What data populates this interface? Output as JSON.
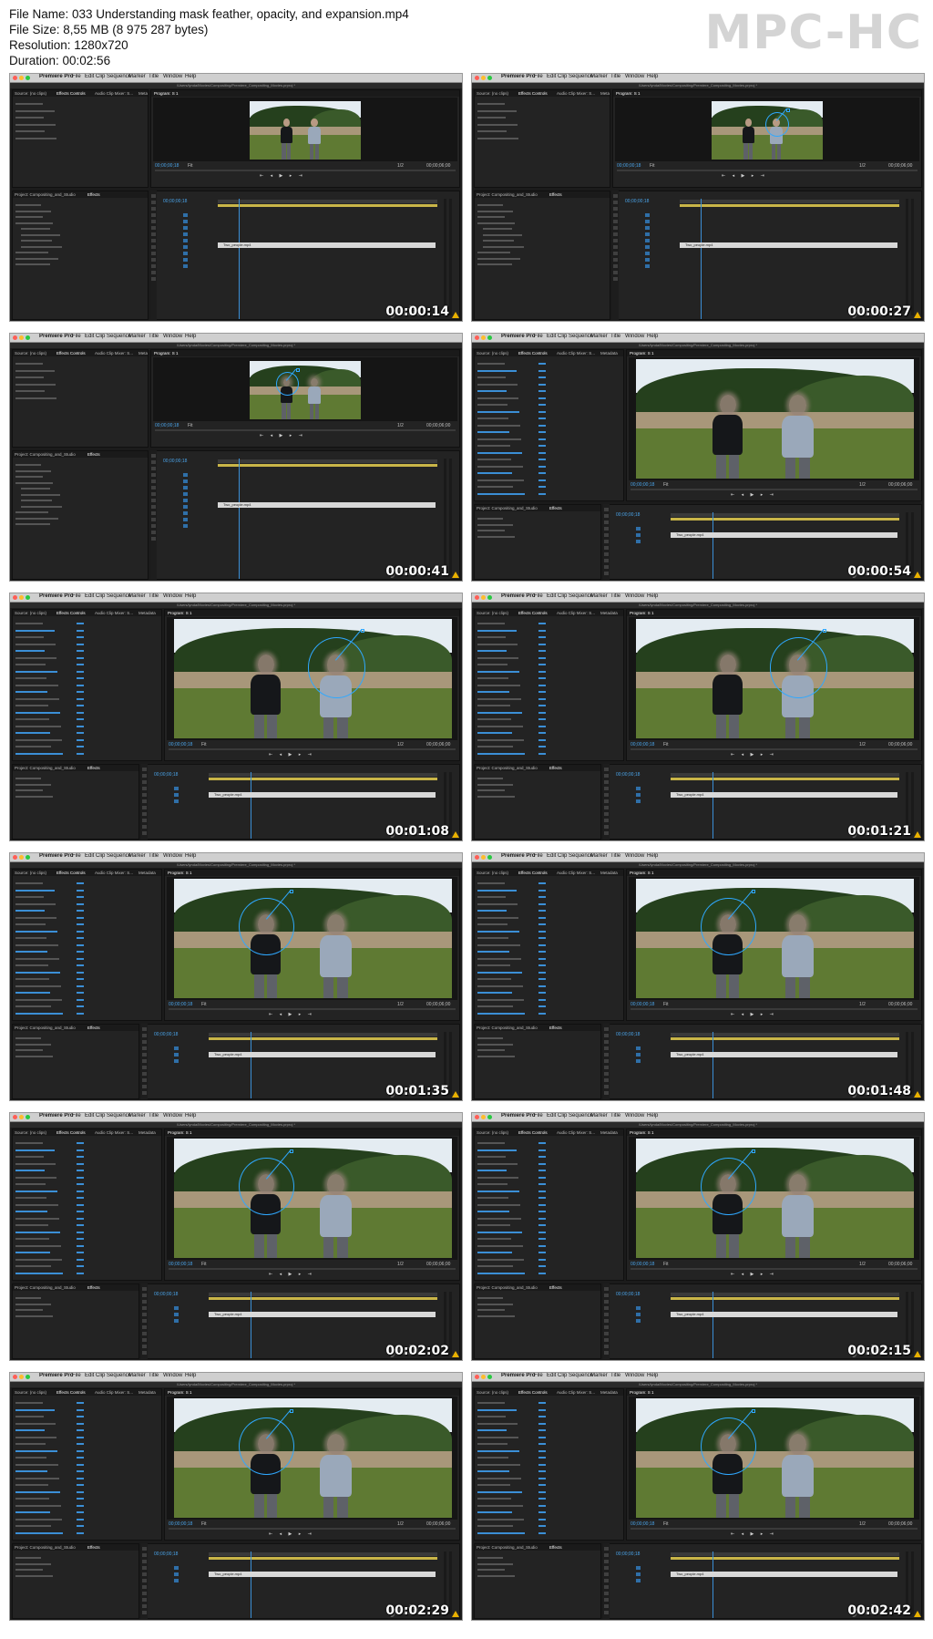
{
  "header": {
    "file_name": "File Name: 033 Understanding mask feather, opacity, and expansion.mp4",
    "file_size": "File Size: 8,55 MB (8 975 287 bytes)",
    "resolution": "Resolution: 1280x720",
    "duration": "Duration: 00:02:56",
    "logo": "MPC-HC"
  },
  "app": {
    "menu": [
      "Premiere Pro",
      "File",
      "Edit",
      "Clip",
      "Sequence",
      "Marker",
      "Title",
      "Window",
      "Help"
    ],
    "window_title": "/Users/lynda/Movies/Compositing/Premiere_Compositing_Movies.prproj *",
    "tabs_top": [
      "Source: (no clips)",
      "Effects Controls",
      "Audio Clip Mixer: S...",
      "Metadata"
    ],
    "tab_program": "Program: S 1",
    "tabs_bottom_left": [
      "Project: Compositing_and_Studio",
      "Effects"
    ],
    "timecode": "00;00;00;18",
    "timecode_end": "00;00;06;00",
    "fit": "Fit",
    "ratio": "1/2",
    "effects_rows": [
      "Presets",
      "Audio Effects",
      "Audio Transitions",
      "Video Effects",
      "Blur & Sharpen",
      "Face Blur",
      "Color Correction",
      "Fast Color Corrector",
      "Video Transitions",
      "Obsolete FX",
      "Lumetri Looks"
    ],
    "controls_rows": [
      "Motion",
      "Opacity",
      "Time Remapping",
      "Face Blur",
      "Mask (1)",
      "Mask Path",
      "Mask Feather",
      "Mask Opacity",
      "Mask Expansion",
      "Inverted",
      "Mask (2)",
      "Blurriness"
    ],
    "clip_name": "Two_people.mp4",
    "watermark": "lynda"
  },
  "thumbnails": [
    {
      "stamp": "00:00:14",
      "layout": "small"
    },
    {
      "stamp": "00:00:27",
      "layout": "small"
    },
    {
      "stamp": "00:00:41",
      "layout": "small"
    },
    {
      "stamp": "00:00:54",
      "layout": "large"
    },
    {
      "stamp": "00:01:08",
      "layout": "large"
    },
    {
      "stamp": "00:01:21",
      "layout": "large"
    },
    {
      "stamp": "00:01:35",
      "layout": "large"
    },
    {
      "stamp": "00:01:48",
      "layout": "large"
    },
    {
      "stamp": "00:02:02",
      "layout": "large"
    },
    {
      "stamp": "00:02:15",
      "layout": "large"
    },
    {
      "stamp": "00:02:29",
      "layout": "large"
    },
    {
      "stamp": "00:02:42",
      "layout": "large"
    }
  ],
  "colors": {
    "accent": "#2fa8ff",
    "panel": "#232323",
    "stamp": "#ffffff"
  }
}
